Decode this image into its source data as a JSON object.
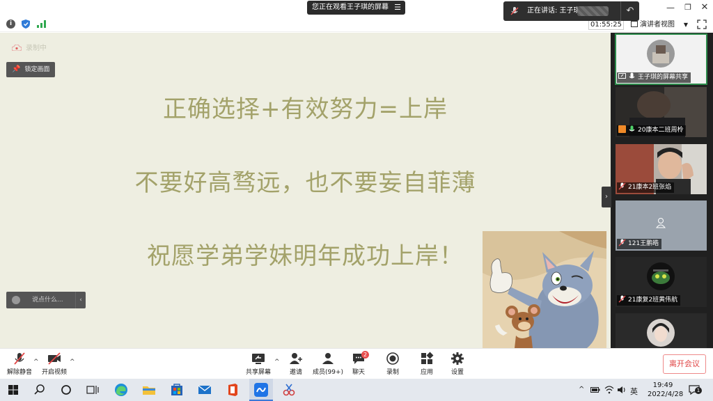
{
  "titlebar": {
    "sharing_banner": "您正在观看王子琪的屏幕",
    "banner_menu_icon": "menu-icon",
    "window_controls": [
      "minimize-icon",
      "maximize-icon",
      "close-icon"
    ]
  },
  "speaking_popup": {
    "text": "正在讲话: 王子琪"
  },
  "infobar": {
    "timer": "01:55:25",
    "view_mode": "演讲者视图"
  },
  "content": {
    "recording_label": "录制中",
    "lock_screen_label": "锁定画面",
    "slide_lines": [
      "正确选择+有效努力=上岸",
      "不要好高骛远，也不要妄自菲薄",
      "祝愿学弟学妹明年成功上岸！"
    ],
    "chat_placeholder": "说点什么..."
  },
  "participants": [
    {
      "name": "王子琪的屏幕共享",
      "active": true
    },
    {
      "name": "20康本二班周柃",
      "active": false
    },
    {
      "name": "21康本2班张焰",
      "active": false
    },
    {
      "name": "121王鹏皓",
      "active": false
    },
    {
      "name": "21康复2班黄伟航",
      "active": false
    },
    {
      "name": "",
      "active": false
    }
  ],
  "toolbar": {
    "unmute_label": "解除静音",
    "start_video_label": "开启视频",
    "share_label": "共享屏幕",
    "invite_label": "邀请",
    "members_label": "成员(99+)",
    "chat_label": "聊天",
    "chat_badge": "2",
    "record_label": "录制",
    "apps_label": "应用",
    "settings_label": "设置",
    "leave_label": "离开会议"
  },
  "taskbar": {
    "time": "19:49",
    "date": "2022/4/28",
    "ime": "英",
    "notification_count": "1"
  },
  "colors": {
    "slide_background": "#eeeee1",
    "slide_text": "#a3a26a",
    "active_tile_border": "#2d8c4c",
    "leave_red": "#e04545"
  }
}
